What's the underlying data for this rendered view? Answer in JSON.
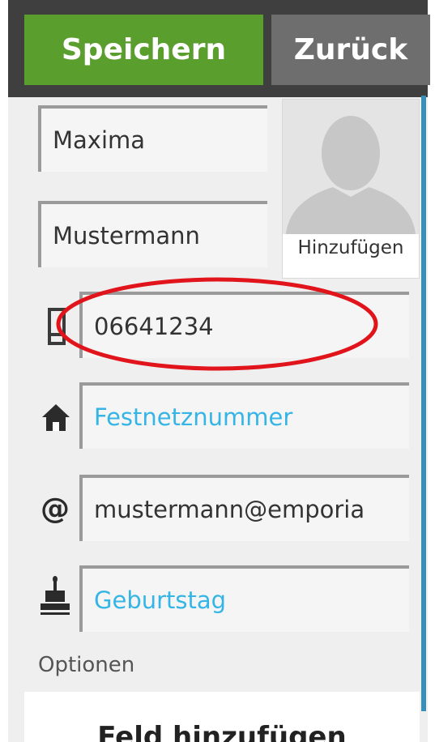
{
  "toolbar": {
    "save_label": "Speichern",
    "back_label": "Zurück"
  },
  "contact": {
    "firstname": "Maxima",
    "lastname": "Mustermann",
    "mobile": "06641234",
    "landline_placeholder": "Festnetznummer",
    "email": "mustermann@emporia",
    "birthday_placeholder": "Geburtstag"
  },
  "avatar": {
    "add_label": "Hinzufügen"
  },
  "options": {
    "title": "Optionen",
    "add_field_label": "Feld hinzufügen"
  },
  "icons": {
    "mobile": "mobile-phone-icon",
    "landline": "home-icon",
    "email": "at-icon",
    "birthday": "cake-icon"
  },
  "colors": {
    "save_button": "#5a9e2e",
    "back_button": "#6e6e6e",
    "topbar": "#3f3f3f",
    "placeholder_text": "#35b5e5",
    "scrollbar": "#3a8fb7",
    "highlight_annotation": "#e0141a"
  }
}
